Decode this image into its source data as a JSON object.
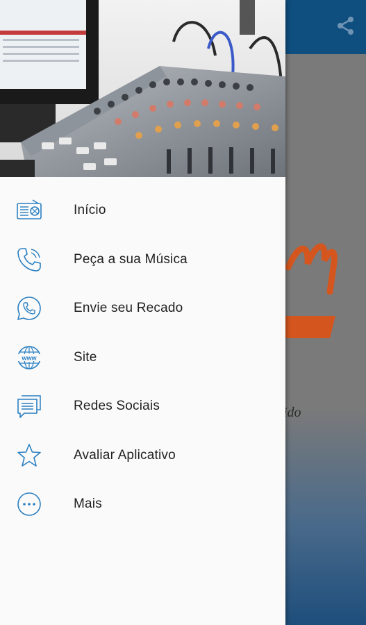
{
  "colors": {
    "accent": "#2a7fc1",
    "toolbar": "#0f4f80",
    "drawer_bg": "#fafafa",
    "text": "#1f1f1f"
  },
  "header": {
    "image": "mixing-console-photo"
  },
  "app": {
    "toolbar_action": "share-icon",
    "tagline_fragment": "ido"
  },
  "menu": {
    "items": [
      {
        "label": "Início",
        "icon": "radio-icon"
      },
      {
        "label": "Peça a sua Música",
        "icon": "phone-icon"
      },
      {
        "label": "Envie seu Recado",
        "icon": "whatsapp-icon"
      },
      {
        "label": "Site",
        "icon": "globe-www-icon"
      },
      {
        "label": "Redes Sociais",
        "icon": "chat-bubbles-icon"
      },
      {
        "label": "Avaliar Aplicativo",
        "icon": "star-icon"
      },
      {
        "label": "Mais",
        "icon": "more-icon"
      }
    ]
  }
}
